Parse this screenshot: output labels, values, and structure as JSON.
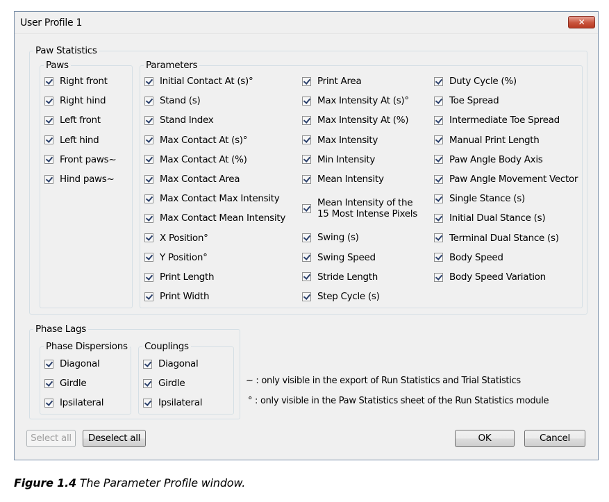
{
  "window": {
    "title": "User Profile 1",
    "close_label": "✕"
  },
  "paw_statistics": {
    "title": "Paw Statistics",
    "paws": {
      "title": "Paws",
      "items": [
        "Right front",
        "Right hind",
        "Left front",
        "Left hind",
        "Front paws~",
        "Hind paws~"
      ]
    },
    "parameters": {
      "title": "Parameters",
      "col1": [
        "Initial Contact At (s)°",
        "Stand (s)",
        "Stand Index",
        "Max Contact At (s)°",
        "Max Contact At (%)",
        "Max Contact Area",
        "Max Contact Max Intensity",
        "Max Contact Mean Intensity",
        "X Position°",
        "Y Position°",
        "Print Length",
        "Print Width"
      ],
      "col2": [
        "Print Area",
        "Max Intensity At (s)°",
        "Max Intensity At (%)",
        "Max Intensity",
        "Min Intensity",
        "Mean Intensity",
        "Mean Intensity of the 15 Most Intense Pixels",
        "Swing (s)",
        "Swing Speed",
        "Stride Length",
        "Step Cycle (s)"
      ],
      "col3": [
        "Duty Cycle (%)",
        "Toe Spread",
        "Intermediate Toe Spread",
        "Manual Print Length",
        "Paw Angle Body Axis",
        "Paw Angle Movement Vector",
        "Single Stance (s)",
        "Initial Dual Stance (s)",
        "Terminal Dual Stance (s)",
        "Body Speed",
        "Body Speed Variation"
      ]
    }
  },
  "phase_lags": {
    "title": "Phase Lags",
    "dispersions": {
      "title": "Phase Dispersions",
      "items": [
        "Diagonal",
        "Girdle",
        "Ipsilateral"
      ]
    },
    "couplings": {
      "title": "Couplings",
      "items": [
        "Diagonal",
        "Girdle",
        "Ipsilateral"
      ]
    }
  },
  "notes": {
    "tilde": "~ : only visible in the export of Run Statistics and Trial Statistics",
    "degree": "° : only visible in the Paw Statistics sheet of the Run Statistics module"
  },
  "buttons": {
    "select_all": "Select all",
    "deselect_all": "Deselect all",
    "ok": "OK",
    "cancel": "Cancel"
  },
  "caption": {
    "label": "Figure 1.4",
    "text": "The Parameter Profile window."
  }
}
